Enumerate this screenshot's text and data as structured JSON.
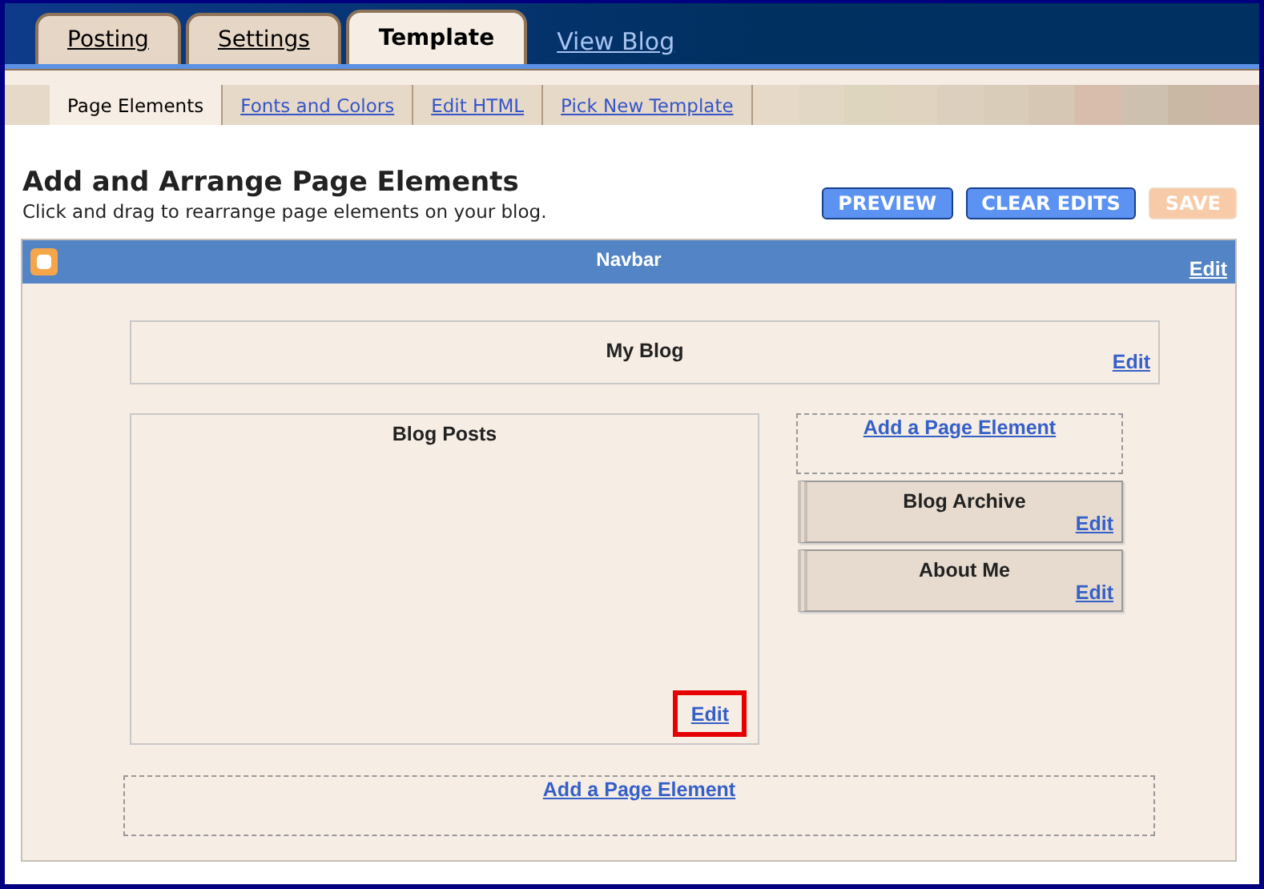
{
  "top_tabs": [
    {
      "label": "Posting",
      "selected": false,
      "kind": "tab"
    },
    {
      "label": "Settings",
      "selected": false,
      "kind": "tab"
    },
    {
      "label": "Template",
      "selected": true,
      "kind": "tab"
    },
    {
      "label": "View Blog",
      "selected": false,
      "kind": "link"
    }
  ],
  "sub_tabs": [
    {
      "label": "Page Elements",
      "selected": true
    },
    {
      "label": "Fonts and Colors",
      "selected": false
    },
    {
      "label": "Edit HTML",
      "selected": false
    },
    {
      "label": "Pick New Template",
      "selected": false
    }
  ],
  "heading": {
    "title": "Add and Arrange Page Elements",
    "subtitle": "Click and drag to rearrange page elements on your blog."
  },
  "buttons": [
    {
      "label": "PREVIEW",
      "disabled": false
    },
    {
      "label": "CLEAR EDITS",
      "disabled": false
    },
    {
      "label": "SAVE",
      "disabled": true
    }
  ],
  "navbar": {
    "title": "Navbar",
    "edit": "Edit"
  },
  "header": {
    "title": "My Blog",
    "edit": "Edit"
  },
  "main": {
    "title": "Blog Posts",
    "edit": "Edit",
    "highlighted": true
  },
  "sidebar": {
    "add_link": "Add a Page Element",
    "widgets": [
      {
        "title": "Blog Archive",
        "edit": "Edit"
      },
      {
        "title": "About Me",
        "edit": "Edit"
      }
    ]
  },
  "footer": {
    "add_link": "Add a Page Element"
  }
}
